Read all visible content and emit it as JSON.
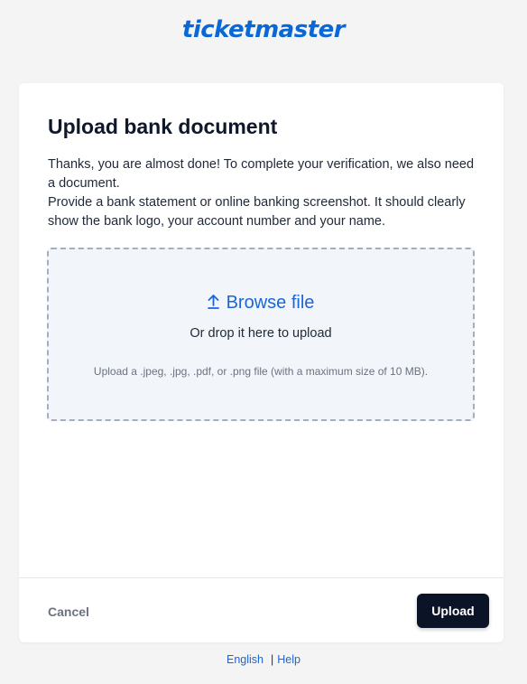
{
  "brand": {
    "logo_text": "ticketmaster",
    "color": "#0a68d6"
  },
  "dialog": {
    "title": "Upload bank document",
    "description_line1": "Thanks, you are almost done! To complete your verification, we also need a document.",
    "description_line2": "Provide a bank statement or online banking screenshot. It should clearly show the bank logo, your account number and your name."
  },
  "dropzone": {
    "browse_label": "Browse file",
    "browse_icon": "upload-arrow-icon",
    "drop_text": "Or drop it here to upload",
    "hint": "Upload a .jpeg, .jpg, .pdf, or .png file (with a maximum size of 10 MB)."
  },
  "actions": {
    "cancel_label": "Cancel",
    "upload_label": "Upload",
    "upload_bg": "#0b1426"
  },
  "footer": {
    "language_label": "English",
    "separator": "|",
    "help_label": "Help",
    "link_color": "#1a66d8"
  }
}
